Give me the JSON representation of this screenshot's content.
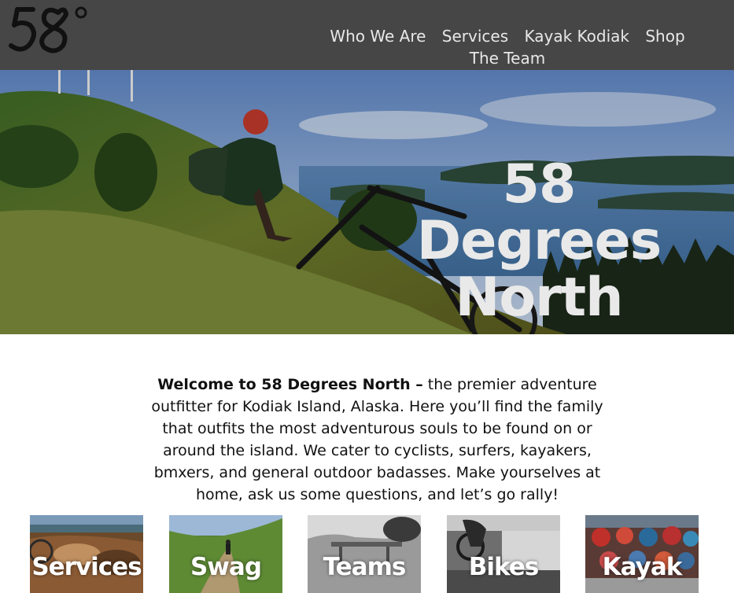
{
  "header": {
    "logo_text": "58°",
    "nav": [
      {
        "label": "Who We Are"
      },
      {
        "label": "Services"
      },
      {
        "label": "Kayak Kodiak"
      },
      {
        "label": "Shop"
      },
      {
        "label": "The Team"
      }
    ]
  },
  "hero": {
    "title_line1": "58 Degrees",
    "title_line2": "North"
  },
  "intro": {
    "lead": "Welcome to 58 Degrees North –",
    "body": " the premier adventure outfitter for Kodiak Island, Alaska. Here you’ll find the family that outfits the most adventurous souls to be found on or around the island. We cater to cyclists, surfers, kayakers, bmxers, and general outdoor badasses. Make yourselves at home, ask us some questions, and let’s go rally!"
  },
  "tiles": [
    {
      "label": "Services"
    },
    {
      "label": "Swag"
    },
    {
      "label": "Teams"
    },
    {
      "label": "Bikes"
    },
    {
      "label": "Kayak"
    }
  ],
  "colors": {
    "header_bg": "#464646",
    "nav_text": "#e8e8e8",
    "hero_title": "#e9e9e9",
    "body_text": "#111111"
  }
}
